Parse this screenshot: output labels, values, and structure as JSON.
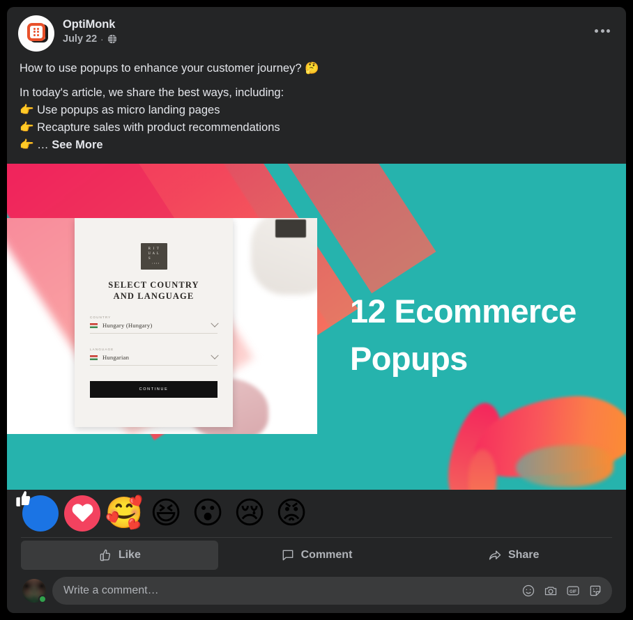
{
  "theme": {
    "page_bg": "#000000",
    "card_bg": "#242526",
    "text_primary": "#e4e6eb",
    "text_secondary": "#b0b3b8",
    "accent_blue": "#1b74e4",
    "banner_teal": "#26b3ad",
    "online_green": "#31a24c"
  },
  "post": {
    "author": "OptiMonk",
    "timestamp": "July 22",
    "separator": "·",
    "privacy_icon": "globe-icon",
    "menu_icon": "more-options-icon",
    "avatar_icon": "optimonk-logo",
    "text": {
      "line1": "How to use popups to enhance your customer journey? 🤔",
      "line2": "In today's article, we share the best ways, including:",
      "bullet1": "👉 Use popups as micro landing pages",
      "bullet2": "👉 Recapture sales with product recommendations",
      "bullet3_prefix": "👉 ",
      "bullet3_ellipsis": "… ",
      "see_more": "See More"
    }
  },
  "banner": {
    "headline_line1": "12 Ecommerce",
    "headline_line2": "Popups",
    "popup_preview": {
      "brand_letters": [
        "R",
        "I",
        "T",
        "U",
        "A",
        "L",
        "S"
      ],
      "brand_sub": "1 9 8 8",
      "title_line1": "SELECT COUNTRY",
      "title_line2": "AND LANGUAGE",
      "country_label": "COUNTRY",
      "country_value": "Hungary (Hungary)",
      "language_label": "LANGUAGE",
      "language_value": "Hungarian",
      "continue_label": "CONTINUE",
      "flag_icon": "hungary-flag-icon",
      "chevron_icon": "chevron-down-icon"
    }
  },
  "reactions": [
    {
      "name": "like",
      "label": "Like",
      "glyph": "",
      "bg": "#1b74e4"
    },
    {
      "name": "love",
      "label": "Love",
      "glyph": "",
      "bg": "#f3425f"
    },
    {
      "name": "care",
      "label": "Care",
      "glyph": "🥰",
      "bg": "transparent"
    },
    {
      "name": "haha",
      "label": "Haha",
      "glyph": "😆",
      "bg": "transparent"
    },
    {
      "name": "wow",
      "label": "Wow",
      "glyph": "😮",
      "bg": "transparent"
    },
    {
      "name": "sad",
      "label": "Sad",
      "glyph": "😢",
      "bg": "transparent"
    },
    {
      "name": "angry",
      "label": "Angry",
      "glyph": "😡",
      "bg": "transparent"
    }
  ],
  "actions": {
    "like": {
      "label": "Like",
      "icon": "thumbs-up-icon",
      "active": true
    },
    "comment": {
      "label": "Comment",
      "icon": "comment-bubble-icon",
      "active": false
    },
    "share": {
      "label": "Share",
      "icon": "share-arrow-icon",
      "active": false
    }
  },
  "composer": {
    "avatar_icon": "user-avatar",
    "status": "online",
    "placeholder": "Write a comment…",
    "value": "",
    "icons": [
      {
        "name": "emoji-icon",
        "label": "Emoji"
      },
      {
        "name": "camera-icon",
        "label": "Camera"
      },
      {
        "name": "gif-icon",
        "label": "GIF"
      },
      {
        "name": "sticker-icon",
        "label": "Sticker"
      }
    ]
  }
}
